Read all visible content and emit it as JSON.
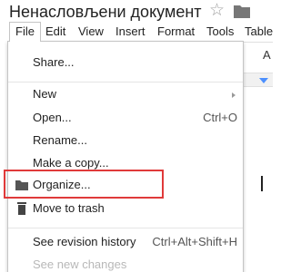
{
  "doc": {
    "title": "Ненасловљени документ",
    "star_icon": "star-icon",
    "folder_icon": "folder-icon"
  },
  "menubar": {
    "items": [
      {
        "label": "File",
        "active": true
      },
      {
        "label": "Edit"
      },
      {
        "label": "View"
      },
      {
        "label": "Insert"
      },
      {
        "label": "Format"
      },
      {
        "label": "Tools"
      },
      {
        "label": "Table"
      }
    ]
  },
  "behind": {
    "toolbar_letter": "A"
  },
  "file_menu": {
    "share": {
      "label": "Share..."
    },
    "new": {
      "label": "New",
      "submenu_icon": "submenu-arrow-icon"
    },
    "open": {
      "label": "Open...",
      "shortcut": "Ctrl+O"
    },
    "rename": {
      "label": "Rename..."
    },
    "make_copy": {
      "label": "Make a copy..."
    },
    "organize": {
      "label": "Organize...",
      "icon": "folder-icon",
      "highlighted": true
    },
    "move_to_trash": {
      "label": "Move to trash",
      "icon": "trash-icon"
    },
    "revision_history": {
      "label": "See revision history",
      "shortcut": "Ctrl+Alt+Shift+H"
    },
    "new_changes": {
      "label": "See new changes",
      "disabled": true
    }
  },
  "colors": {
    "highlight_border": "#e03a3a",
    "ruler_marker": "#4d90fe",
    "disabled_text": "#b8b8b8"
  }
}
